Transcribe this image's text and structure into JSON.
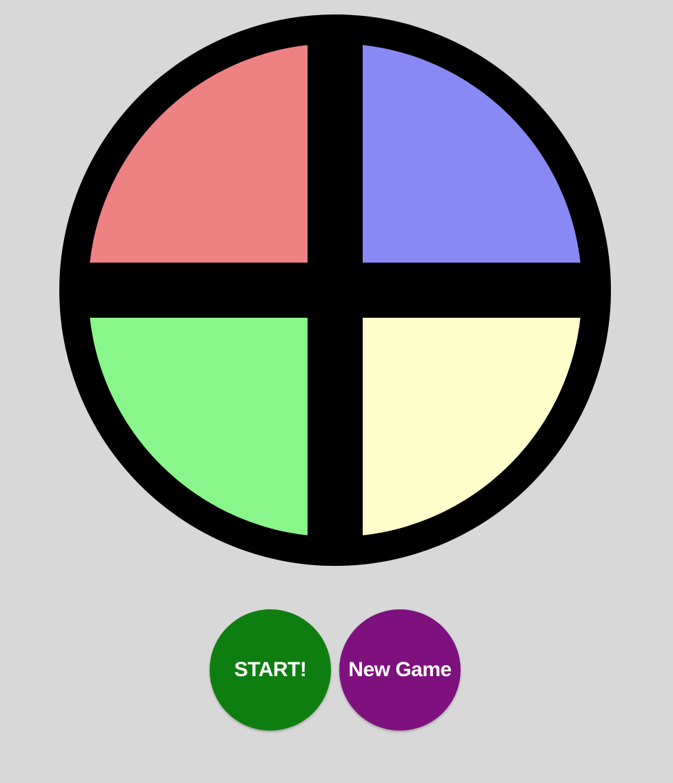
{
  "board": {
    "colors": {
      "red": "#ee8282",
      "blue": "#8989f5",
      "green": "#89f68b",
      "yellow": "#ffffcc",
      "frame": "#000000",
      "background": "#d8d8d8"
    }
  },
  "controls": {
    "start_label": "START!",
    "start_color": "#0e7e11",
    "new_game_label": "New Game",
    "new_game_color": "#7e117e"
  }
}
